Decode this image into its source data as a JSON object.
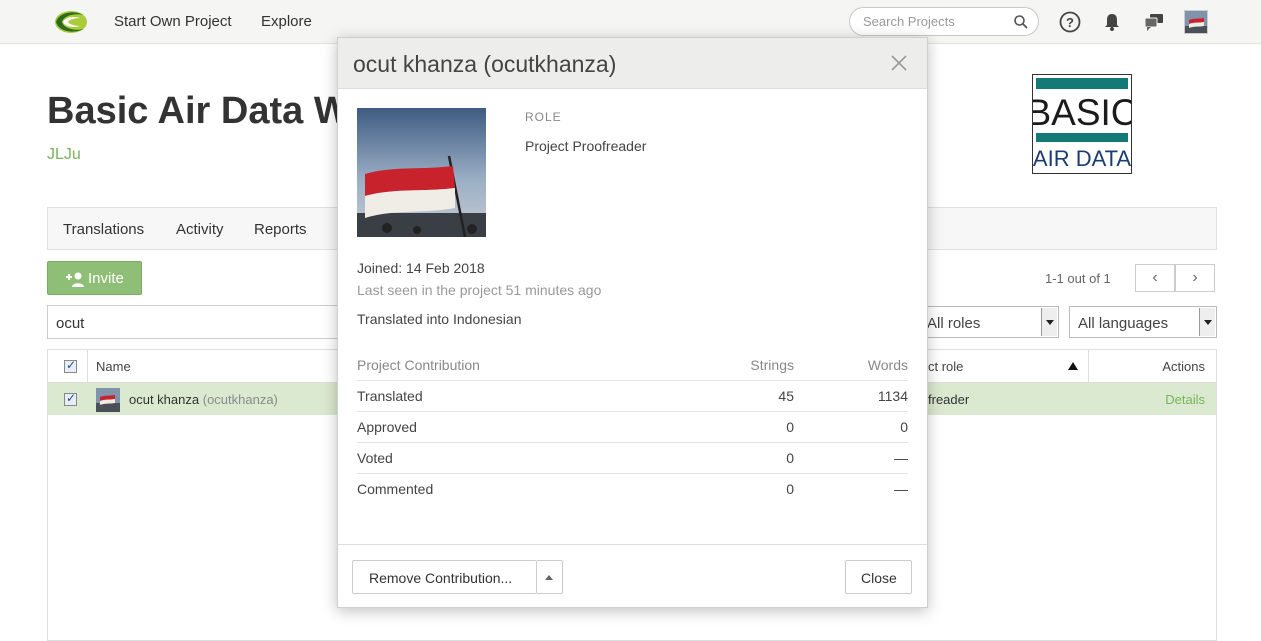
{
  "topnav": {
    "links": [
      "Start Own Project",
      "Explore"
    ],
    "search_placeholder": "Search Projects"
  },
  "project": {
    "title": "Basic Air Data W",
    "owner": "JLJu",
    "logo_text_top": "BASIC",
    "logo_text_bottom": "AIR DATA"
  },
  "tabs": [
    "Translations",
    "Activity",
    "Reports"
  ],
  "invite_label": "Invite",
  "pager": {
    "text": "1-1 out of 1",
    "prev": "‹",
    "next": "›"
  },
  "filter": {
    "value": "ocut"
  },
  "selects": {
    "roles": "All roles",
    "languages": "All languages"
  },
  "table": {
    "headers": {
      "name": "Name",
      "role": "ct role",
      "actions": "Actions"
    },
    "row": {
      "name": "ocut khanza",
      "username": "(ocutkhanza)",
      "role": "freader",
      "action": "Details"
    }
  },
  "modal": {
    "title": "ocut khanza (ocutkhanza)",
    "role_label": "ROLE",
    "role_value": "Project Proofreader",
    "joined": "Joined: 14 Feb 2018",
    "last_seen": "Last seen in the project 51 minutes ago",
    "translated_into": "Translated into Indonesian",
    "contribution": {
      "headers": [
        "Project Contribution",
        "Strings",
        "Words"
      ],
      "rows": [
        {
          "label": "Translated",
          "strings": "45",
          "words": "1134"
        },
        {
          "label": "Approved",
          "strings": "0",
          "words": "0"
        },
        {
          "label": "Voted",
          "strings": "0",
          "words": "—"
        },
        {
          "label": "Commented",
          "strings": "0",
          "words": "—"
        }
      ]
    },
    "remove_button": "Remove Contribution...",
    "close_button": "Close"
  },
  "colors": {
    "accent_green": "#79b35c",
    "invite_green": "#8fbf76",
    "row_highlight": "#dbe9d0",
    "logo_teal": "#137a78",
    "logo_navy": "#1b3d73"
  }
}
